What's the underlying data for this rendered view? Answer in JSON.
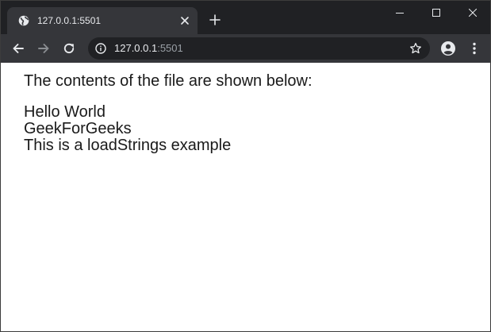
{
  "tab": {
    "title": "127.0.0.1:5501"
  },
  "address_bar": {
    "host": "127.0.0.1",
    "port": ":5501"
  },
  "icons": {
    "favicon": "globe-icon",
    "tab_close": "close-icon",
    "new_tab": "plus-icon",
    "minimize": "minimize-icon",
    "maximize": "maximize-icon",
    "close_window": "close-icon",
    "back": "arrow-left-icon",
    "forward": "arrow-right-icon",
    "reload": "reload-icon",
    "site_info": "info-icon",
    "bookmark": "star-icon",
    "profile": "account-icon",
    "menu": "kebab-menu-icon"
  },
  "colors": {
    "tabstrip_bg": "#202124",
    "toolbar_bg": "#35363a",
    "omnibox_bg": "#202124",
    "text_light": "#e8eaed",
    "text_dim": "#9aa0a6",
    "page_text": "#1a1a1a"
  },
  "page": {
    "intro": "The contents of the file are shown below:",
    "lines": [
      "Hello World",
      "GeekForGeeks",
      "This is a loadStrings example"
    ]
  }
}
